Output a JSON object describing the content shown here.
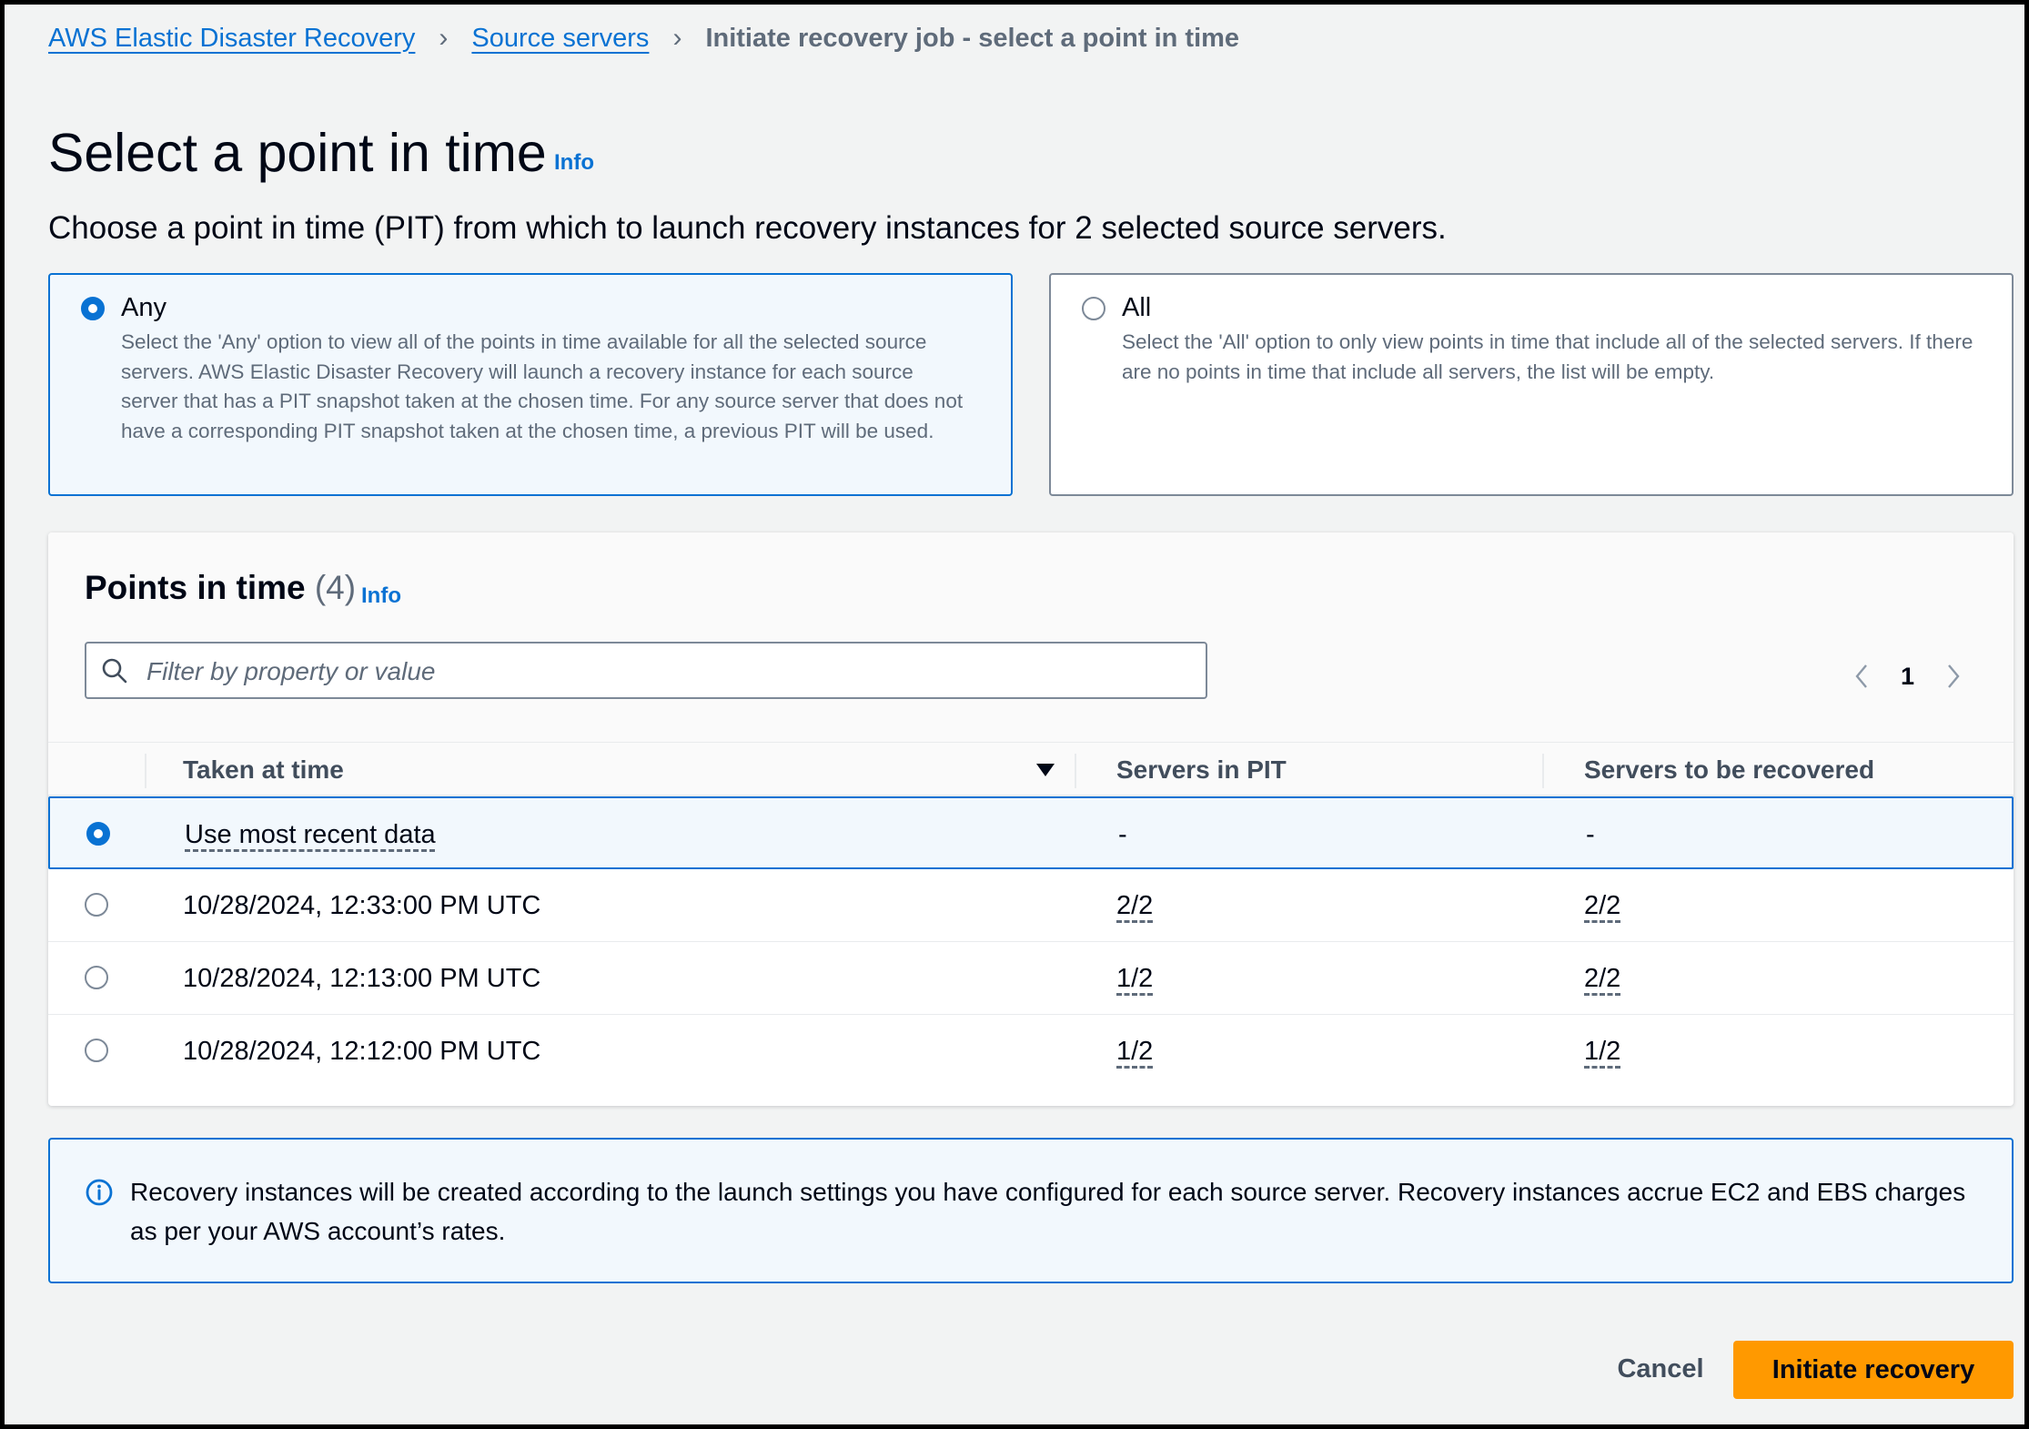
{
  "breadcrumb": {
    "items": [
      "AWS Elastic Disaster Recovery",
      "Source servers"
    ],
    "current": "Initiate recovery job - select a point in time"
  },
  "header": {
    "title": "Select a point in time",
    "info": "Info",
    "description": "Choose a point in time (PIT) from which to launch recovery instances for 2 selected source servers."
  },
  "options": {
    "any": {
      "label": "Any",
      "selected": true,
      "description": "Select the 'Any' option to view all of the points in time available for all the selected source servers. AWS Elastic Disaster Recovery will launch a recovery instance for each source server that has a PIT snapshot taken at the chosen time. For any source server that does not have a corresponding PIT snapshot taken at the chosen time, a previous PIT will be used."
    },
    "all": {
      "label": "All",
      "selected": false,
      "description": "Select the 'All' option to only view points in time that include all of the selected servers. If there are no points in time that include all servers, the list will be empty."
    }
  },
  "points": {
    "title": "Points in time",
    "count": "(4)",
    "info": "Info",
    "search_placeholder": "Filter by property or value",
    "page": "1",
    "columns": [
      "Taken at time",
      "Servers in PIT",
      "Servers to be recovered"
    ],
    "rows": [
      {
        "time": "Use most recent data",
        "in_pit": "-",
        "to_recover": "-",
        "selected": true
      },
      {
        "time": "10/28/2024, 12:33:00 PM UTC",
        "in_pit": "2/2",
        "to_recover": "2/2",
        "selected": false
      },
      {
        "time": "10/28/2024, 12:13:00 PM UTC",
        "in_pit": "1/2",
        "to_recover": "2/2",
        "selected": false
      },
      {
        "time": "10/28/2024, 12:12:00 PM UTC",
        "in_pit": "1/2",
        "to_recover": "1/2",
        "selected": false
      }
    ]
  },
  "alert": {
    "icon": "info-circle-icon",
    "text": "Recovery instances will be created according to the launch settings you have configured for each source server. Recovery instances accrue EC2 and EBS charges as per your AWS account’s rates."
  },
  "footer": {
    "cancel": "Cancel",
    "primary": "Initiate recovery"
  },
  "colors": {
    "accent": "#0972d3",
    "primary_button": "#ff9900",
    "selected_bg": "#f2f8fd"
  }
}
